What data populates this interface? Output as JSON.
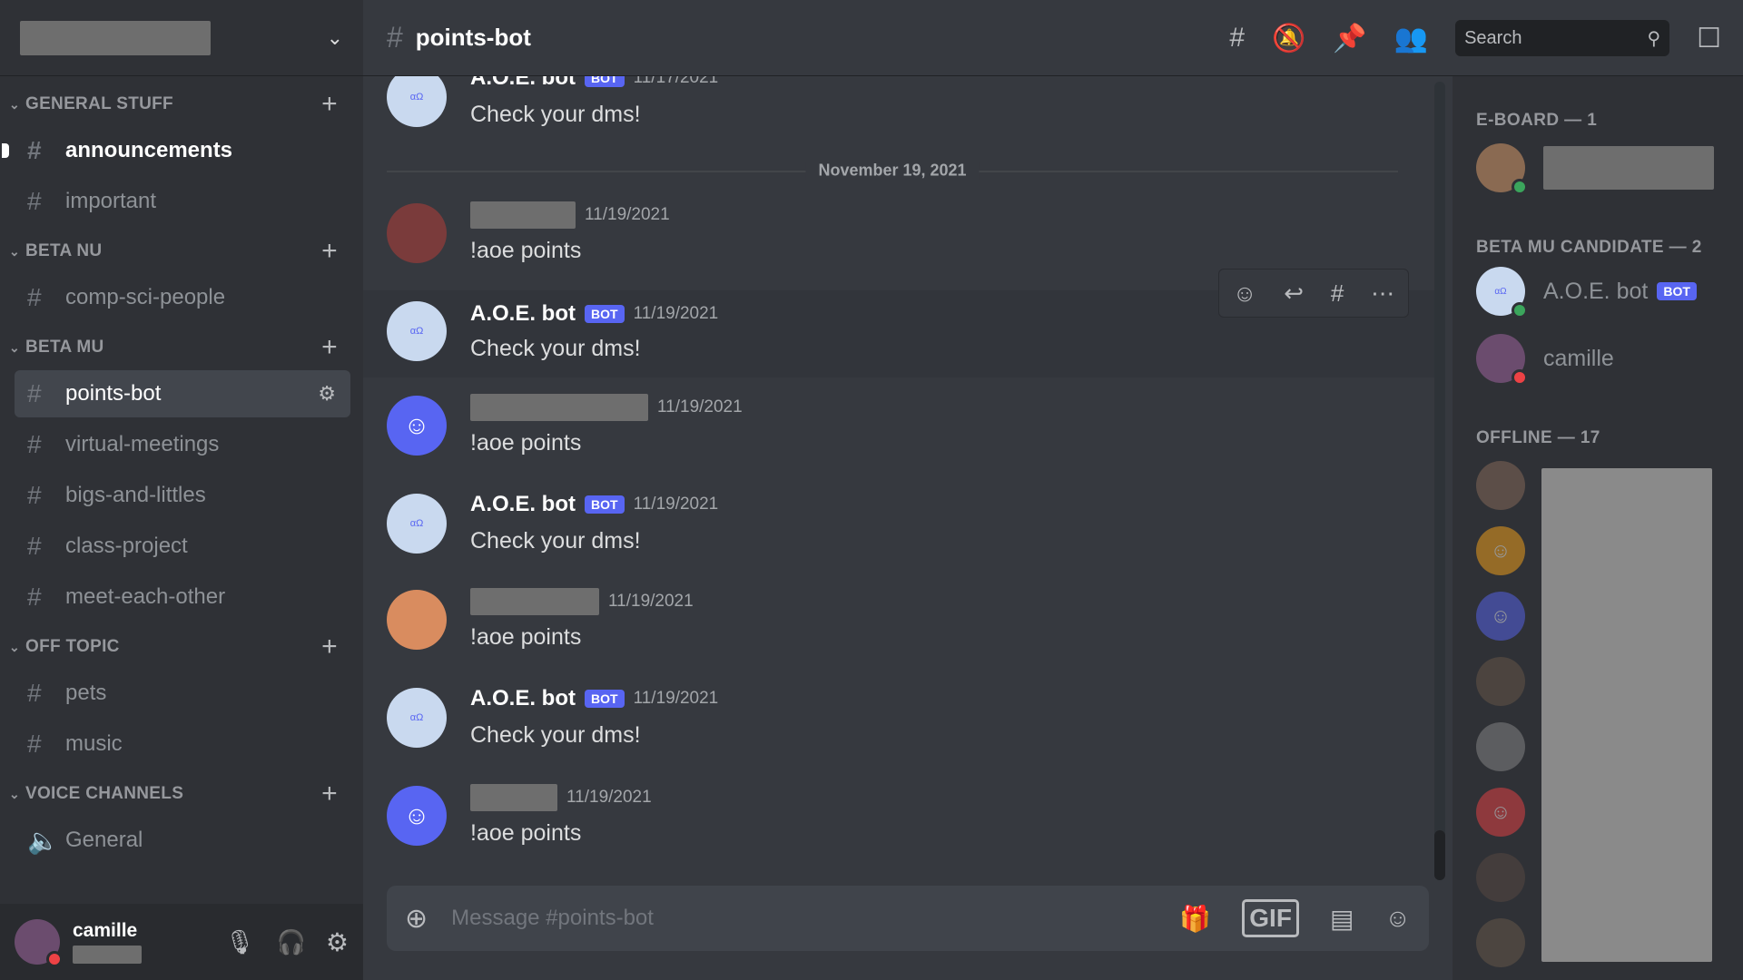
{
  "server": {
    "name_redacted": true
  },
  "categories": [
    {
      "label": "GENERAL STUFF",
      "channels": [
        {
          "name": "announcements",
          "unread": true
        },
        {
          "name": "important"
        }
      ]
    },
    {
      "label": "BETA NU",
      "channels": [
        {
          "name": "comp-sci-people"
        }
      ]
    },
    {
      "label": "BETA MU",
      "channels": [
        {
          "name": "points-bot",
          "active": true
        },
        {
          "name": "virtual-meetings"
        },
        {
          "name": "bigs-and-littles"
        },
        {
          "name": "class-project"
        },
        {
          "name": "meet-each-other"
        }
      ]
    },
    {
      "label": "OFF TOPIC",
      "channels": [
        {
          "name": "pets"
        },
        {
          "name": "music"
        }
      ]
    },
    {
      "label": "VOICE CHANNELS",
      "channels": [
        {
          "name": "General",
          "voice": true
        }
      ]
    }
  ],
  "user": {
    "name": "camille"
  },
  "header": {
    "channel": "points-bot",
    "search_placeholder": "Search"
  },
  "date_divider": "November 19, 2021",
  "messages": [
    {
      "author": "A.O.E. bot",
      "bot": true,
      "badge": "BOT",
      "time": "11/17/2021",
      "text": "Check your dms!"
    },
    {
      "author": "",
      "time": "11/19/2021",
      "text": "!aoe points"
    },
    {
      "author": "A.O.E. bot",
      "bot": true,
      "badge": "BOT",
      "time": "11/19/2021",
      "text": "Check your dms!"
    },
    {
      "author": "",
      "time": "11/19/2021",
      "text": "!aoe points"
    },
    {
      "author": "A.O.E. bot",
      "bot": true,
      "badge": "BOT",
      "time": "11/19/2021",
      "text": "Check your dms!"
    },
    {
      "author": "",
      "time": "11/19/2021",
      "text": "!aoe points"
    },
    {
      "author": "A.O.E. bot",
      "bot": true,
      "badge": "BOT",
      "time": "11/19/2021",
      "text": "Check your dms!"
    },
    {
      "author": "",
      "time": "11/19/2021",
      "text": "!aoe points"
    }
  ],
  "composer": {
    "placeholder": "Message #points-bot",
    "gif_label": "GIF"
  },
  "members": {
    "eboard_label": "E-BOARD — 1",
    "candidate_label": "BETA MU CANDIDATE — 2",
    "bot_name": "A.O.E. bot",
    "bot_badge": "BOT",
    "camille": "camille",
    "offline_label": "OFFLINE — 17"
  },
  "colors": {
    "accent": "#5865f2",
    "online": "#3ba55c",
    "dnd": "#ed4245"
  }
}
